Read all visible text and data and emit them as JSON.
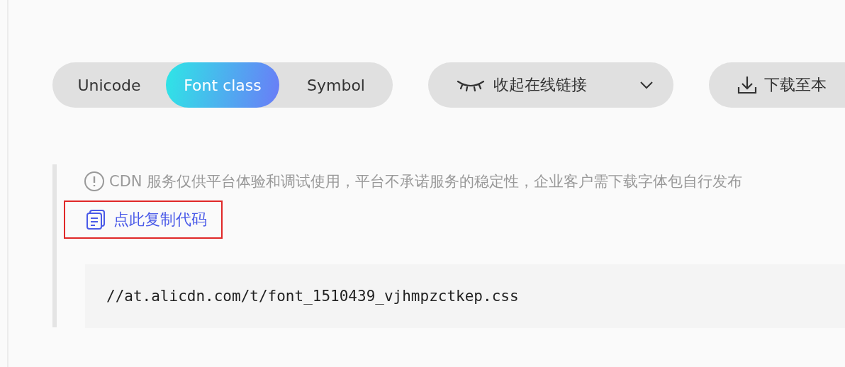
{
  "tabs": [
    {
      "label": "Unicode",
      "selected": false
    },
    {
      "label": "Font class",
      "selected": true
    },
    {
      "label": "Symbol",
      "selected": false
    }
  ],
  "link_toggle": {
    "label": "收起在线链接",
    "expanded": true
  },
  "download_button": {
    "label": "下载至本"
  },
  "notice": {
    "text": "CDN 服务仅供平台体验和调试使用，平台不承诺服务的稳定性，企业客户需下载字体包自行发布"
  },
  "copy_link": {
    "label": "点此复制代码",
    "highlighted": true
  },
  "code": "//at.alicdn.com/t/font_1510439_vjhmpzctkep.css"
}
